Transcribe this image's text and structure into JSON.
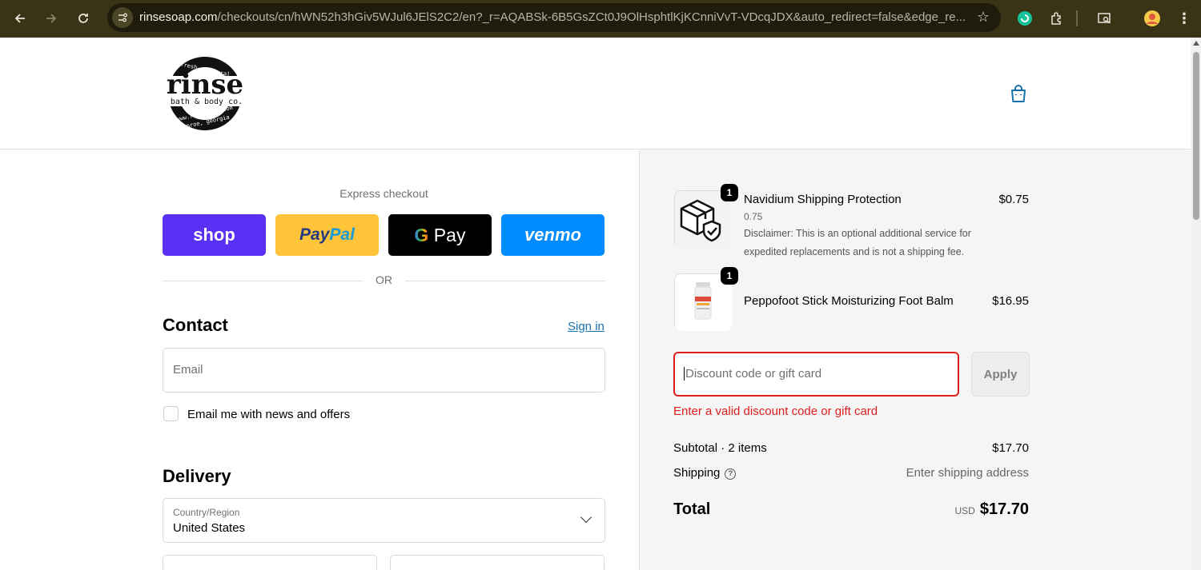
{
  "browser": {
    "url_host": "rinsesoap.com",
    "url_path": "/checkouts/cn/hWN52h3hGiv5WJul6JElS2C2/en?_r=AQABSk-6B5GsZCt0J9OlHsphtlKjKCnniVvT-VDcqJDX&auto_redirect=false&edge_re...",
    "icons": [
      "back-icon",
      "forward-icon",
      "reload-icon",
      "site-info-icon",
      "star-icon",
      "extension-grammarly-icon",
      "extensions-icon",
      "tab-search-icon",
      "profile-avatar",
      "menu-icon"
    ]
  },
  "header": {
    "logo_text": "rinse",
    "logo_ring_top": "fresh • natural",
    "logo_sub": "bath & body co.",
    "logo_url": "www.rinsesoap.com",
    "logo_ring_bottom": "monroe, georgia",
    "cart_icon": "bag-icon"
  },
  "express": {
    "label": "Express checkout",
    "shop_label": "shop",
    "paypal_a": "Pay",
    "paypal_b": "Pal",
    "gpay_g": "G",
    "gpay_label": " Pay",
    "venmo_label": "venmo",
    "or": "OR"
  },
  "contact": {
    "title": "Contact",
    "signin": "Sign in",
    "email_placeholder": "Email",
    "news_label": "Email me with news and offers"
  },
  "delivery": {
    "title": "Delivery",
    "country_label": "Country/Region",
    "country_value": "United States"
  },
  "summary": {
    "items": [
      {
        "qty": "1",
        "name": "Navidium Shipping Protection",
        "variant": "0.75",
        "disclaimer": "Disclaimer: This is an optional additional service for expedited replacements and is not a shipping fee.",
        "price": "$0.75"
      },
      {
        "qty": "1",
        "name": "Peppofoot Stick Moisturizing Foot Balm",
        "price": "$16.95"
      }
    ],
    "discount_placeholder": "Discount code or gift card",
    "apply": "Apply",
    "error": "Enter a valid discount code or gift card",
    "subtotal_label": "Subtotal · 2 items",
    "subtotal_value": "$17.70",
    "shipping_label": "Shipping",
    "shipping_value": "Enter shipping address",
    "total_label": "Total",
    "currency": "USD",
    "total_value": "$17.70",
    "colors": {
      "error": "#dd1d1d",
      "link": "#1773b0",
      "shop": "#5a31f4",
      "paypal": "#ffc439",
      "venmo": "#008cff"
    }
  }
}
